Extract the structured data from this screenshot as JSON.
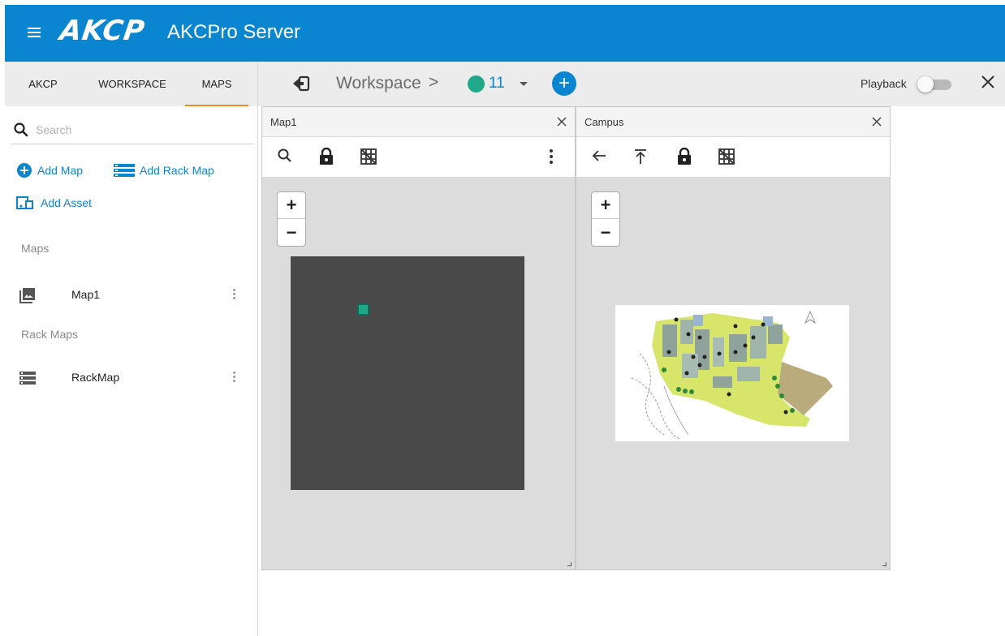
{
  "header": {
    "logo_text": "AKCP",
    "app_title": "AKCPro Server"
  },
  "sidebar": {
    "tabs": [
      {
        "label": "AKCP",
        "active": false
      },
      {
        "label": "WORKSPACE",
        "active": false
      },
      {
        "label": "MAPS",
        "active": true
      }
    ],
    "search": {
      "placeholder": "Search",
      "value": ""
    },
    "actions": {
      "add_map": "Add Map",
      "add_rack_map": "Add Rack Map",
      "add_asset": "Add Asset"
    },
    "maps_section": {
      "label": "Maps",
      "items": [
        {
          "label": "Map1",
          "icon": "image-icon"
        }
      ]
    },
    "rack_maps_section": {
      "label": "Rack Maps",
      "items": [
        {
          "label": "RackMap",
          "icon": "rack-icon"
        }
      ]
    }
  },
  "workspace_bar": {
    "title": "Workspace",
    "separator": ">",
    "count": "11",
    "playback_label": "Playback",
    "playback_on": false
  },
  "panels": [
    {
      "title": "Map1",
      "tools": [
        "search-icon",
        "lock-icon",
        "grid-off-icon",
        "more-vert-icon"
      ],
      "zoom_in": "+",
      "zoom_out": "−"
    },
    {
      "title": "Campus",
      "tools": [
        "arrow-left-icon",
        "upload-top-icon",
        "lock-icon",
        "grid-off-icon"
      ],
      "zoom_in": "+",
      "zoom_out": "−"
    }
  ],
  "colors": {
    "brand_blue": "#0a86d1",
    "active_tab_underline": "#f08c2c",
    "status_green": "#1fa88a",
    "map_dark": "#494949"
  }
}
